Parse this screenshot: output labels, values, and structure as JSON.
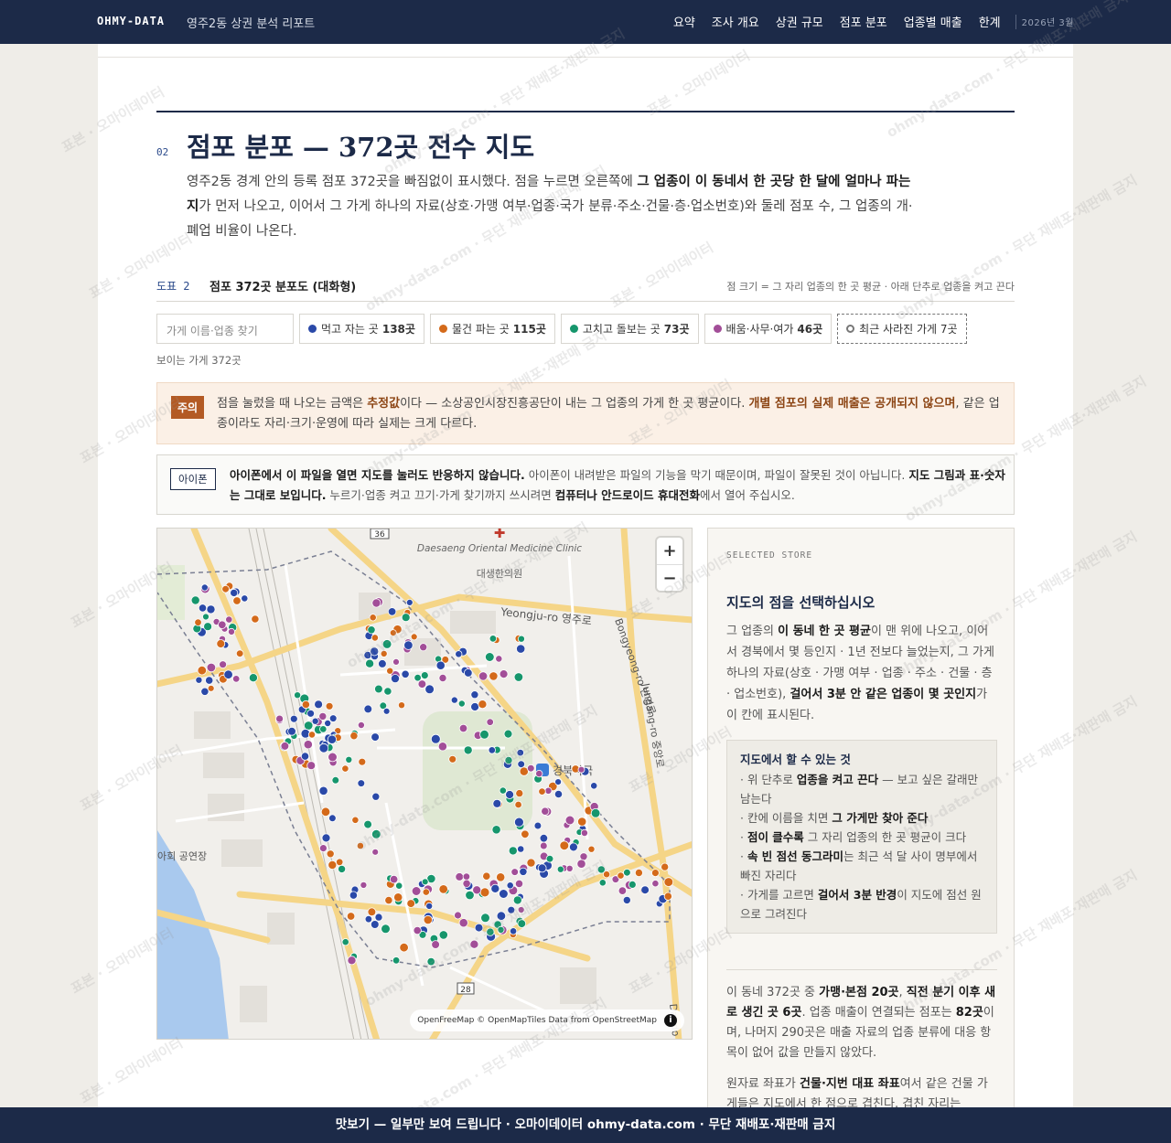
{
  "header": {
    "brand": "OHMY-DATA",
    "report_title": "영주2동 상권 분석 리포트",
    "nav": [
      "요약",
      "조사 개요",
      "상권 규모",
      "점포 분포",
      "업종별 매출",
      "한계"
    ],
    "date": "2026년 3월"
  },
  "section": {
    "number": "02",
    "title": "점포 분포 — 372곳 전수 지도",
    "intro_1": "영주2동 경계 안의 등록 점포 372곳을 빠짐없이 표시했다. 점을 누르면 오른쪽에 ",
    "intro_bold": "그 업종이 이 동네서 한 곳당 한 달에 얼마나 파는지",
    "intro_2": "가 먼저 나오고, 이어서 그 가게 하나의 자료(상호·가맹 여부·업종·국가 분류·주소·건물·층·업소번호)와 둘레 점포 수, 그 업종의 개·폐업 비율이 나온다."
  },
  "figure": {
    "label": "도표 2",
    "title": "점포 372곳 분포도 (대화형)",
    "note": "점 크기 = 그 자리 업종의 한 곳 평균 · 아래 단추로 업종을 켜고 끈다",
    "search_placeholder": "가게 이름·업종 찾기",
    "filters": [
      {
        "label": "먹고 자는 곳",
        "count": "138곳",
        "color": "#2a49a8"
      },
      {
        "label": "물건 파는 곳",
        "count": "115곳",
        "color": "#d46a1a"
      },
      {
        "label": "고치고 돌보는 곳",
        "count": "73곳",
        "color": "#16966c"
      },
      {
        "label": "배움·사무·여가",
        "count": "46곳",
        "color": "#a24e98"
      }
    ],
    "closed_filter": "최근 사라진 가게 7곳",
    "visible_count": "보이는 가게 372곳"
  },
  "caution": {
    "tag": "주의",
    "t1": "점을 눌렀을 때 나오는 금액은 ",
    "b1": "추정값",
    "t2": "이다 — 소상공인시장진흥공단이 내는 그 업종의 가게 한 곳 평균이다. ",
    "b2": "개별 점포의 실제 매출은 공개되지 않으며",
    "t3": ", 같은 업종이라도 자리·크기·운영에 따라 실제는 크게 다르다."
  },
  "iphone": {
    "tag": "아이폰",
    "b1": "아이폰에서 이 파일을 열면 지도를 눌러도 반응하지 않습니다.",
    "t1": " 아이폰이 내려받은 파일의 기능을 막기 때문이며, 파일이 잘못된 것이 아닙니다. ",
    "b2": "지도 그림과 표·숫자는 그대로 보입니다.",
    "t2": " 누르기·업종 켜고 끄기·가게 찾기까지 쓰시려면 ",
    "b3": "컴퓨터나 안드로이드 휴대전화",
    "t3": "에서 열어 주십시오."
  },
  "map": {
    "labels": {
      "clinic_en": "Daesaeng Oriental Medicine Clinic",
      "clinic_ko": "대생한의원",
      "road_yeongju": "Yeongju-ro 영주로",
      "road_bongyeong": "Bongyeong-ro 번영로",
      "road_jungang": "Jungang-ro 중앙로",
      "pharmacy": "경북약국",
      "hall": "아회 공연장",
      "route36": "36",
      "route28": "28",
      "dae_partial": "Daedo"
    },
    "zoom_in": "+",
    "zoom_out": "−",
    "attribution": "OpenFreeMap © OpenMapTiles Data from OpenStreetMap"
  },
  "panel": {
    "eyebrow": "SELECTED STORE",
    "title": "지도의 점을 선택하십시오",
    "d1": "그 업종의 ",
    "d1b": "이 동네 한 곳 평균",
    "d2": "이 맨 위에 나오고, 이어서 경북에서 몇 등인지 · 1년 전보다 늘었는지, 그 가게 하나의 자료(상호 · 가맹 여부 · 업종 · 주소 · 건물 · 층 · 업소번호), ",
    "d2b": "걸어서 3분 안 같은 업종이 몇 곳인지",
    "d3": "가 이 칸에 표시된다.",
    "howto_title": "지도에서 할 수 있는 것",
    "h1": "· 위 단추로 ",
    "h1b": "업종을 켜고 끈다",
    "h1c": " — 보고 싶은 갈래만 남는다",
    "h2": "· 칸에 이름을 치면 ",
    "h2b": "그 가게만 찾아 준다",
    "h3": "· ",
    "h3b": "점이 클수록",
    "h3c": " 그 자리 업종의 한 곳 평균이 크다",
    "h4": "· ",
    "h4b": "속 빈 점선 동그라미",
    "h4c": "는 최근 석 달 사이 명부에서 빠진 자리다",
    "h5": "· 가게를 고르면 ",
    "h5b": "걸어서 3분 반경",
    "h5c": "이 지도에 점선 원으로 그려진다",
    "s1": "이 동네 372곳 중 ",
    "s1b": "가맹·본점 20곳",
    "s2": ", ",
    "s2b": "직전 분기 이후 새로 생긴 곳 6곳",
    "s3": ". 업종 매출이 연결되는 점포는 ",
    "s3b": "82곳",
    "s4": "이며, 나머지 290곳은 매출 자료의 업종 분류에 대응 항목이 없어 값을 만들지 않았다.",
    "c1": "원자료 좌표가 ",
    "c1b": "건물·지번 대표 좌표",
    "c2": "여서 같은 건물 가게들은 지도에서 한 점으로 겹친다. 겹친 자리는"
  },
  "watermark": "표본 · 오마이데이터",
  "watermark2": "ohmy-data.com · 무단 재배포·재판매 금지",
  "footer": "맛보기 — 일부만 보여 드립니다 · 오마이데이터 ohmy-data.com · 무단 재배포·재판매 금지"
}
